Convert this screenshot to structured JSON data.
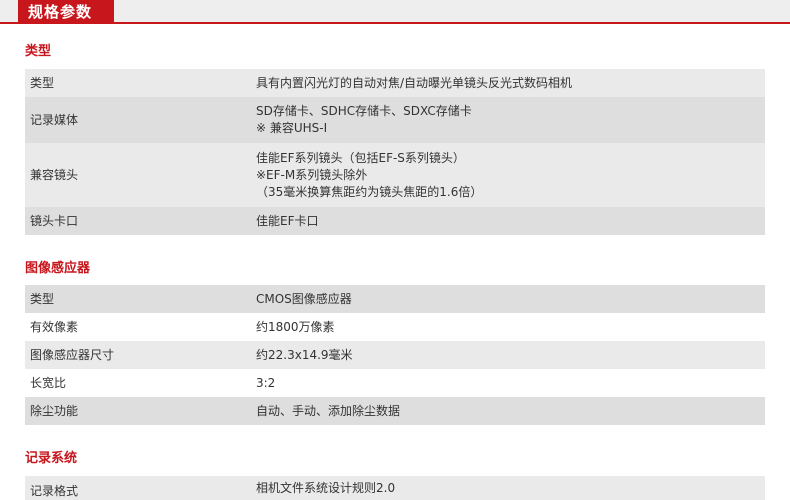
{
  "header": {
    "title": "规格参数"
  },
  "sections": [
    {
      "title": "类型",
      "rows": [
        {
          "label": "类型",
          "lines": [
            "具有内置闪光灯的自动对焦/自动曝光单镜头反光式数码相机"
          ]
        },
        {
          "label": "记录媒体",
          "lines": [
            "SD存储卡、SDHC存储卡、SDXC存储卡",
            "※ 兼容UHS-I"
          ]
        },
        {
          "label": "兼容镜头",
          "lines": [
            "佳能EF系列镜头（包括EF-S系列镜头）",
            "※EF-M系列镜头除外",
            "（35毫米换算焦距约为镜头焦距的1.6倍）"
          ]
        },
        {
          "label": "镜头卡口",
          "lines": [
            "佳能EF卡口"
          ]
        }
      ]
    },
    {
      "title": "图像感应器",
      "rows": [
        {
          "label": "类型",
          "lines": [
            "CMOS图像感应器"
          ]
        },
        {
          "label": "有效像素",
          "lines": [
            "约1800万像素"
          ]
        },
        {
          "label": "图像感应器尺寸",
          "lines": [
            "约22.3x14.9毫米"
          ]
        },
        {
          "label": "长宽比",
          "lines": [
            "3:2"
          ]
        },
        {
          "label": "除尘功能",
          "lines": [
            "自动、手动、添加除尘数据"
          ]
        }
      ]
    },
    {
      "title": "记录系统",
      "rows": [
        {
          "label": "记录格式",
          "lines": [
            "相机文件系统设计规则2.0"
          ]
        }
      ]
    }
  ]
}
